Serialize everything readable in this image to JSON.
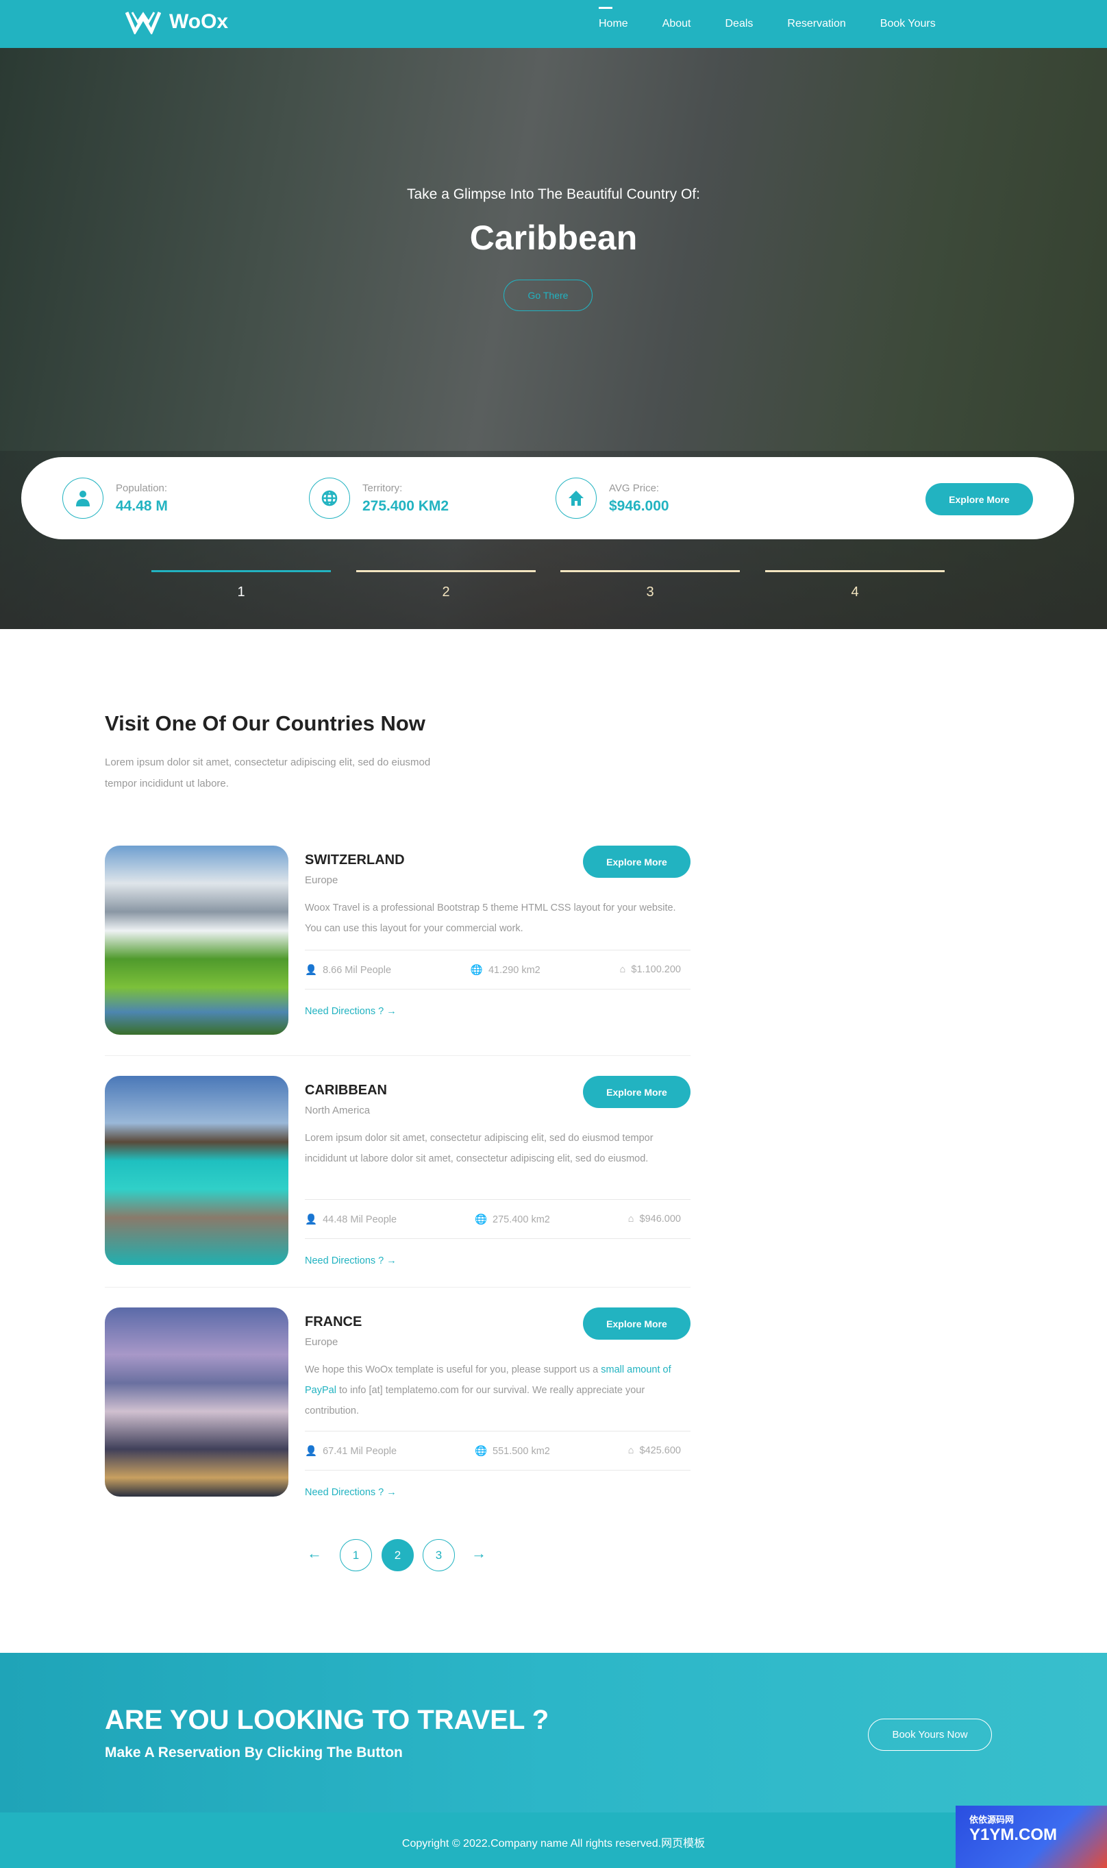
{
  "brand": {
    "name": "WoOx",
    "accent": "#22b3c1"
  },
  "nav": [
    {
      "label": "Home",
      "active": true
    },
    {
      "label": "About"
    },
    {
      "label": "Deals"
    },
    {
      "label": "Reservation"
    },
    {
      "label": "Book Yours"
    }
  ],
  "hero": {
    "subtitle": "Take a Glimpse Into The Beautiful Country Of:",
    "title": "Caribbean",
    "button": "Go There",
    "stats": [
      {
        "icon": "user-icon",
        "label": "Population:",
        "value": "44.48 M"
      },
      {
        "icon": "globe-icon",
        "label": "Territory:",
        "value": "275.400 KM2"
      },
      {
        "icon": "home-icon",
        "label": "AVG Price:",
        "value": "$946.000"
      }
    ],
    "explore": "Explore More",
    "slides": [
      "1",
      "2",
      "3",
      "4"
    ],
    "active_slide": 1
  },
  "section": {
    "title": "Visit One Of Our Countries Now",
    "desc": "Lorem ipsum dolor sit amet, consectetur adipiscing elit, sed do eiusmod tempor incididunt ut labore."
  },
  "countries": [
    {
      "name": "SWITZERLAND",
      "region": "Europe",
      "desc": "Woox Travel is a professional Bootstrap 5 theme HTML CSS layout for your website. You can use this layout for your commercial work.",
      "people": "8.66 Mil People",
      "area": "41.290 km2",
      "price": "$1.100.200",
      "button": "Explore More",
      "link": "Need Directions ?"
    },
    {
      "name": "CARIBBEAN",
      "region": "North America",
      "desc": "Lorem ipsum dolor sit amet, consectetur adipiscing elit, sed do eiusmod tempor incididunt ut labore dolor sit amet, consectetur adipiscing elit, sed do eiusmod.",
      "people": "44.48 Mil People",
      "area": "275.400 km2",
      "price": "$946.000",
      "button": "Explore More",
      "link": "Need Directions ?"
    },
    {
      "name": "FRANCE",
      "region": "Europe",
      "desc_pre": "We hope this WoOx template is useful for you, please support us a ",
      "desc_link": "small amount of PayPal",
      "desc_post": " to info [at] templatemo.com for our survival. We really appreciate your contribution.",
      "people": "67.41 Mil People",
      "area": "551.500 km2",
      "price": "$425.600",
      "button": "Explore More",
      "link": "Need Directions ?"
    }
  ],
  "pagination": {
    "pages": [
      "1",
      "2",
      "3"
    ],
    "current": "2"
  },
  "cta": {
    "title": "ARE YOU LOOKING TO TRAVEL ?",
    "subtitle": "Make A Reservation By Clicking The Button",
    "button": "Book Yours Now"
  },
  "footer": {
    "copyright": "Copyright © 2022.Company name All rights reserved.网页模板"
  },
  "watermark": {
    "line1": "依依源码网",
    "line2": "Y1YM.COM"
  }
}
